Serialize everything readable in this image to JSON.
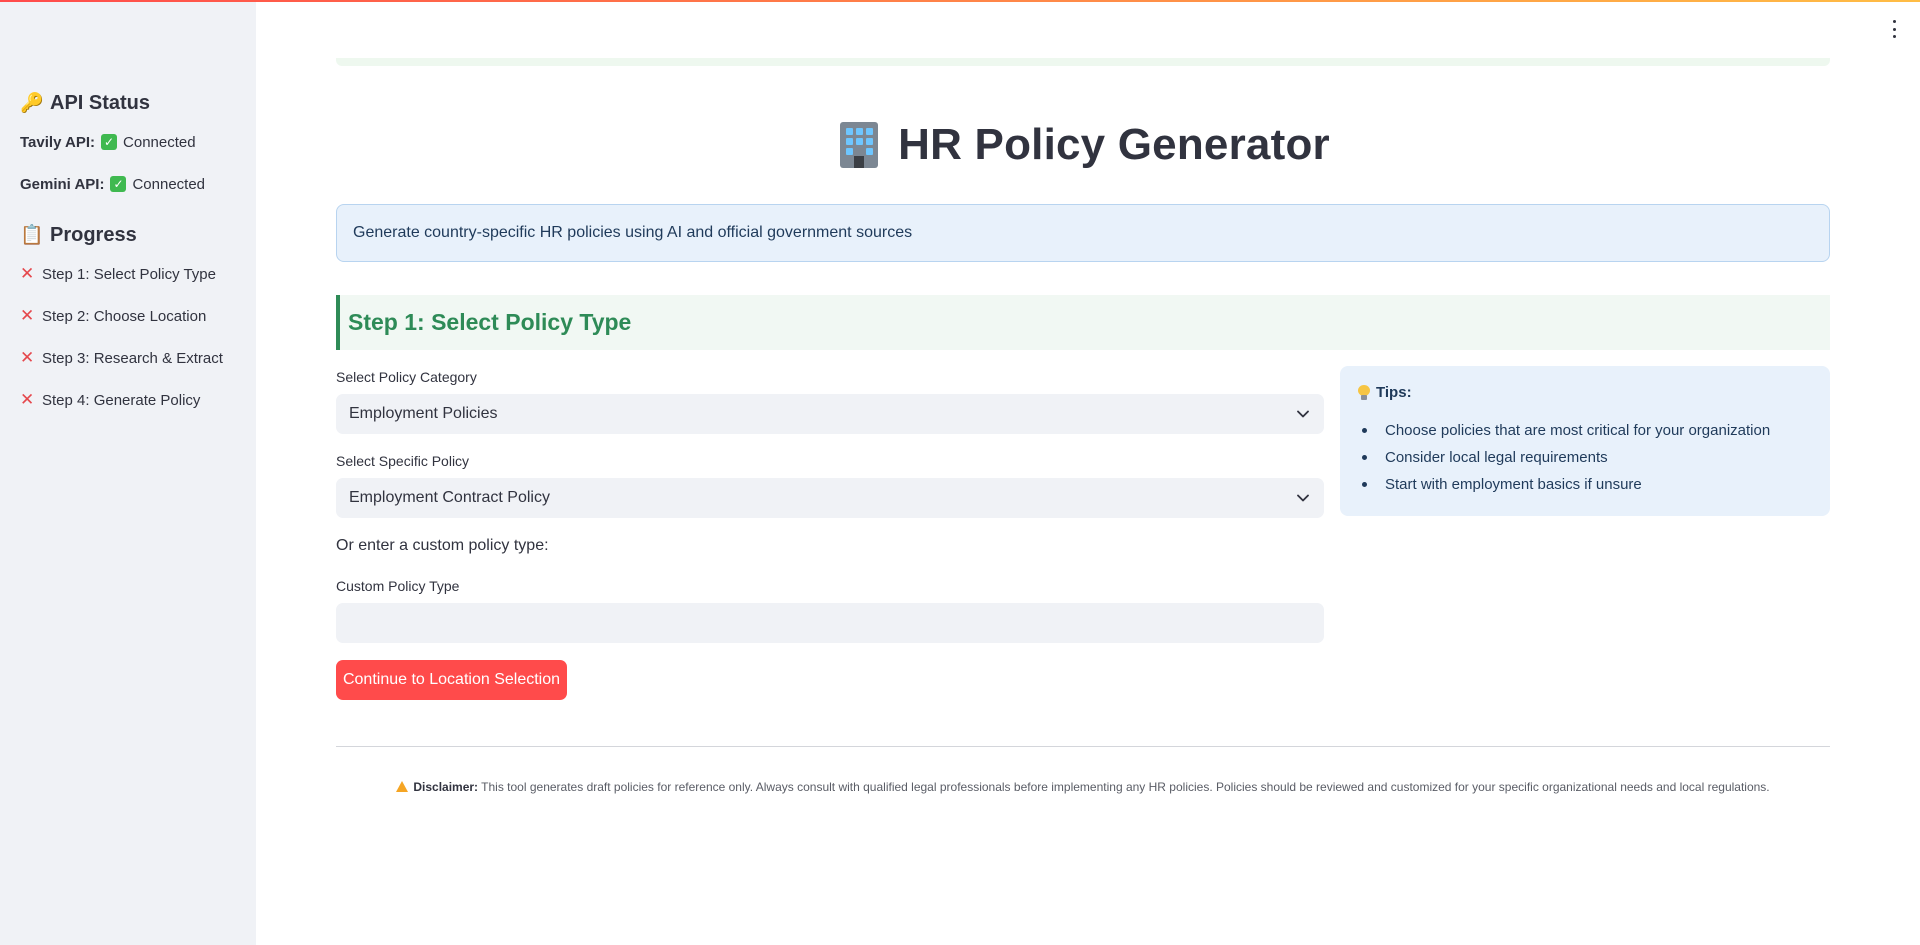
{
  "sidebar": {
    "api_status_emoji": "🔑",
    "api_status_title": "API Status",
    "apis": [
      {
        "name": "Tavily API:",
        "status": "Connected"
      },
      {
        "name": "Gemini API:",
        "status": "Connected"
      }
    ],
    "progress_emoji": "📋",
    "progress_title": "Progress",
    "steps": [
      {
        "label": "Step 1: Select Policy Type",
        "done": false
      },
      {
        "label": "Step 2: Choose Location",
        "done": false
      },
      {
        "label": "Step 3: Research & Extract",
        "done": false
      },
      {
        "label": "Step 4: Generate Policy",
        "done": false
      }
    ]
  },
  "header": {
    "title": "HR Policy Generator",
    "subtitle": "Generate country-specific HR policies using AI and official government sources"
  },
  "step1": {
    "heading": "Step 1: Select Policy Type",
    "category_label": "Select Policy Category",
    "category_value": "Employment Policies",
    "policy_label": "Select Specific Policy",
    "policy_value": "Employment Contract Policy",
    "custom_prompt": "Or enter a custom policy type:",
    "custom_label": "Custom Policy Type",
    "custom_value": "",
    "continue_label": "Continue to Location Selection"
  },
  "tips": {
    "title": "Tips:",
    "items": [
      "Choose policies that are most critical for your organization",
      "Consider local legal requirements",
      "Start with employment basics if unsure"
    ]
  },
  "footer": {
    "disclaimer_label": "Disclaimer:",
    "disclaimer_text": "This tool generates draft policies for reference only. Always consult with qualified legal professionals before implementing any HR policies. Policies should be reviewed and customized for your specific organizational needs and local regulations."
  },
  "colors": {
    "accent": "#ff4b4b",
    "step_green": "#2e8b57",
    "info_blue": "#e8f1fb",
    "sidebar_bg": "#f0f2f6"
  }
}
